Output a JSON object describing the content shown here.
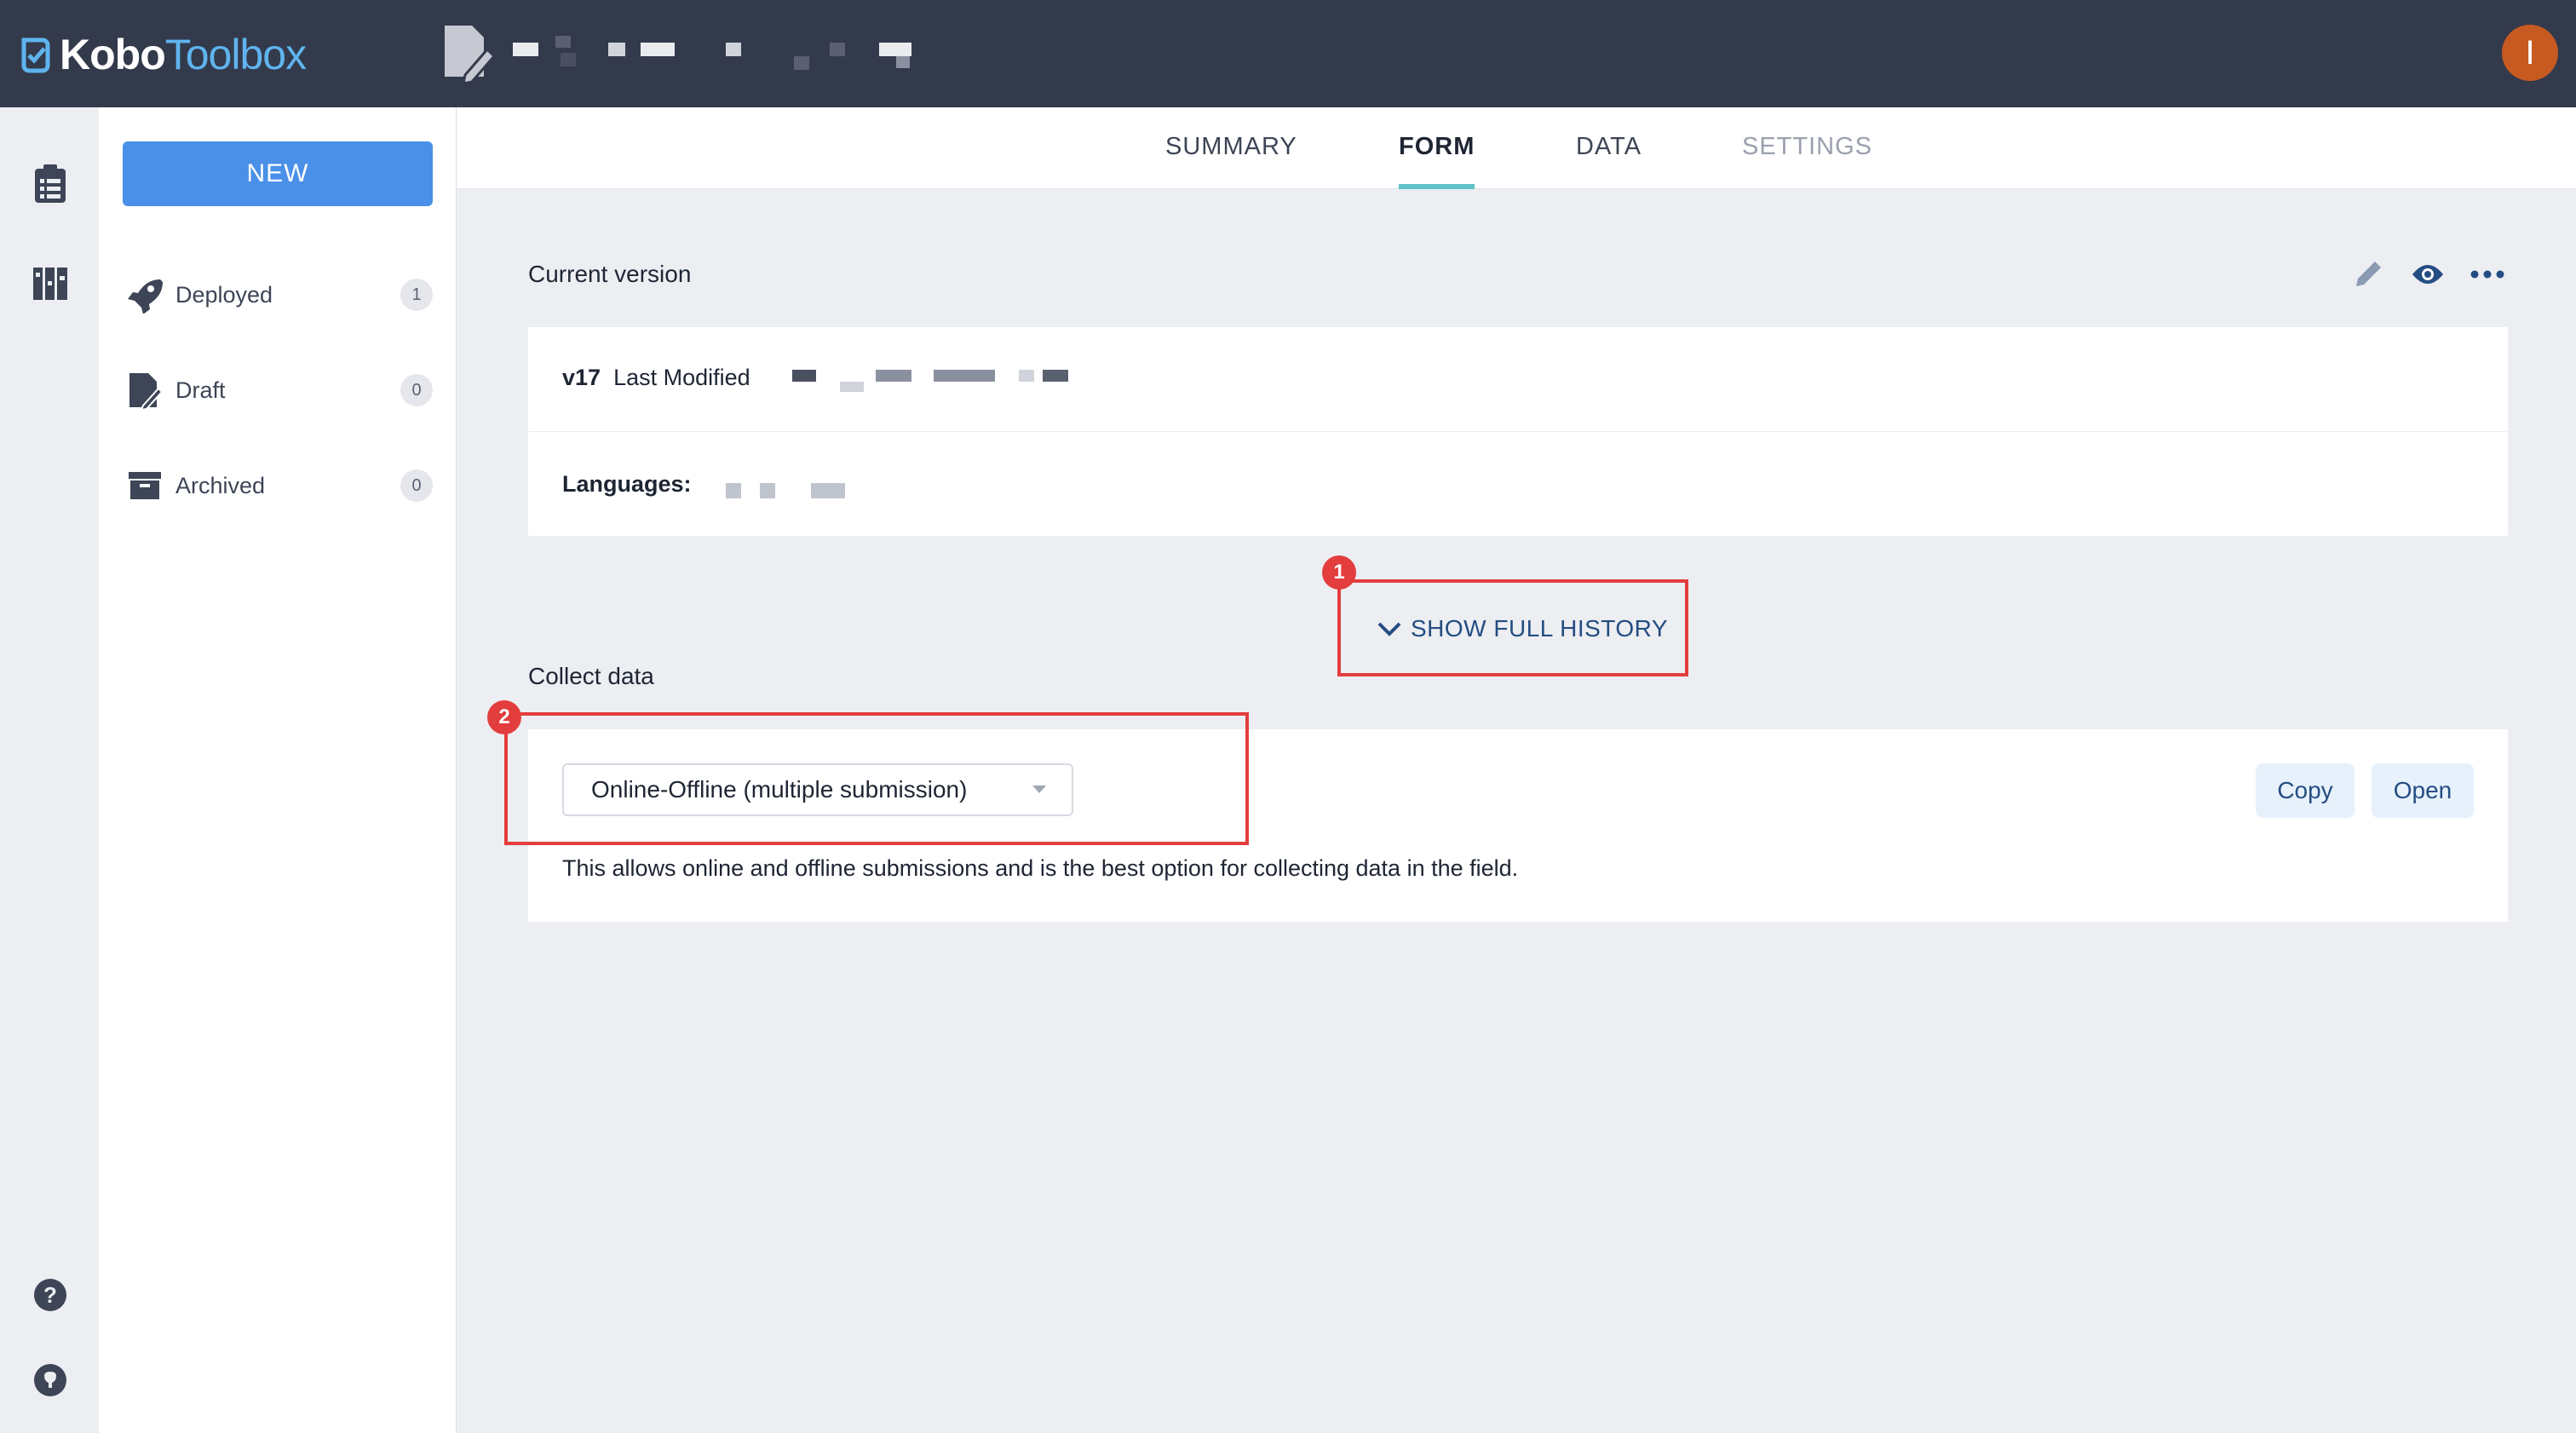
{
  "header": {
    "logo": {
      "bold": "Kobo",
      "light": "Toolbox"
    },
    "avatar_initial": "I"
  },
  "drawer": {
    "new_label": "NEW",
    "items": [
      {
        "label": "Deployed",
        "count": "1",
        "icon": "rocket-icon"
      },
      {
        "label": "Draft",
        "count": "0",
        "icon": "draft-icon"
      },
      {
        "label": "Archived",
        "count": "0",
        "icon": "archive-icon"
      }
    ]
  },
  "tabs": [
    {
      "label": "SUMMARY",
      "state": "normal"
    },
    {
      "label": "FORM",
      "state": "active"
    },
    {
      "label": "DATA",
      "state": "normal"
    },
    {
      "label": "SETTINGS",
      "state": "disabled"
    }
  ],
  "form": {
    "current_version_label": "Current version",
    "version": "v17",
    "last_modified_label": "Last Modified",
    "languages_label": "Languages:",
    "show_history_label": "SHOW FULL HISTORY",
    "collect_data_label": "Collect data",
    "collect_option": "Online-Offline (multiple submission)",
    "copy_label": "Copy",
    "open_label": "Open",
    "helper_text": "This allows online and offline submissions and is the best option for collecting data in the field."
  },
  "annotations": [
    {
      "number": "1"
    },
    {
      "number": "2"
    }
  ],
  "colors": {
    "topbar": "#333a4c",
    "accent": "#4a90e8",
    "tab_indicator": "#5fc2c7",
    "link": "#244d82",
    "annotation": "#e33d3d"
  }
}
